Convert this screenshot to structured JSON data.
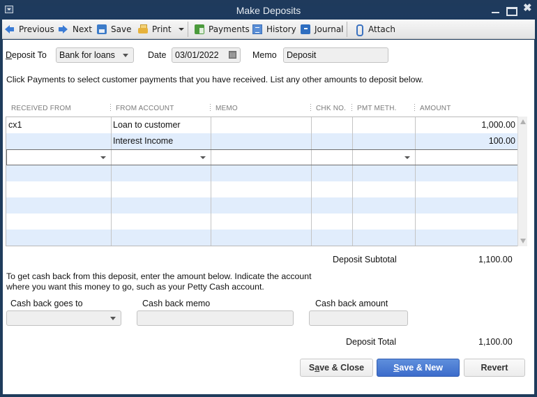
{
  "window": {
    "title": "Make Deposits",
    "controls": [
      "minimize",
      "maximize",
      "close"
    ]
  },
  "toolbar": {
    "items": [
      {
        "label": "Previous",
        "icon": "arrow-left-icon"
      },
      {
        "label": "Next",
        "icon": "arrow-right-icon"
      },
      {
        "label": "Save",
        "icon": "floppy-disk-icon"
      },
      {
        "label": "Print",
        "icon": "printer-icon"
      },
      {
        "label": "Payments",
        "icon": "payments-icon"
      },
      {
        "label": "History",
        "icon": "history-icon"
      },
      {
        "label": "Journal",
        "icon": "journal-icon"
      },
      {
        "label": "Attach",
        "icon": "paperclip-icon"
      }
    ]
  },
  "form": {
    "deposit_to_label": "Deposit To",
    "deposit_to_value": "Bank for loans",
    "date_label": "Date",
    "date_value": "03/01/2022",
    "memo_label": "Memo",
    "memo_value": "Deposit",
    "instructions": "Click Payments to select customer payments that you have received. List any other amounts to deposit below."
  },
  "grid": {
    "columns": [
      "RECEIVED FROM",
      "FROM ACCOUNT",
      "MEMO",
      "CHK NO.",
      "PMT METH.",
      "AMOUNT"
    ],
    "rows": [
      {
        "received_from": "cx1",
        "from_account": "Loan to customer",
        "memo": "",
        "chk_no": "",
        "pmt_meth": "",
        "amount": "1,000.00"
      },
      {
        "received_from": "",
        "from_account": "Interest Income",
        "memo": "",
        "chk_no": "",
        "pmt_meth": "",
        "amount": "100.00"
      }
    ]
  },
  "totals": {
    "subtotal_label": "Deposit Subtotal",
    "subtotal_value": "1,100.00",
    "total_label": "Deposit Total",
    "total_value": "1,100.00"
  },
  "cash_back": {
    "instructions_line1": "To get cash back from this deposit, enter the amount below.  Indicate the account",
    "instructions_line2": "where you want this money to go, such as your Petty Cash account.",
    "goes_to_label": "Cash back goes to",
    "goes_to_value": "",
    "memo_label": "Cash back memo",
    "memo_value": "",
    "amount_label": "Cash back amount",
    "amount_value": ""
  },
  "buttons": {
    "save_close": {
      "pre": "S",
      "ul": "a",
      "post": "ve & Close"
    },
    "save_new": {
      "pre": "",
      "ul": "S",
      "post": "ave & New"
    },
    "revert": "Revert"
  }
}
